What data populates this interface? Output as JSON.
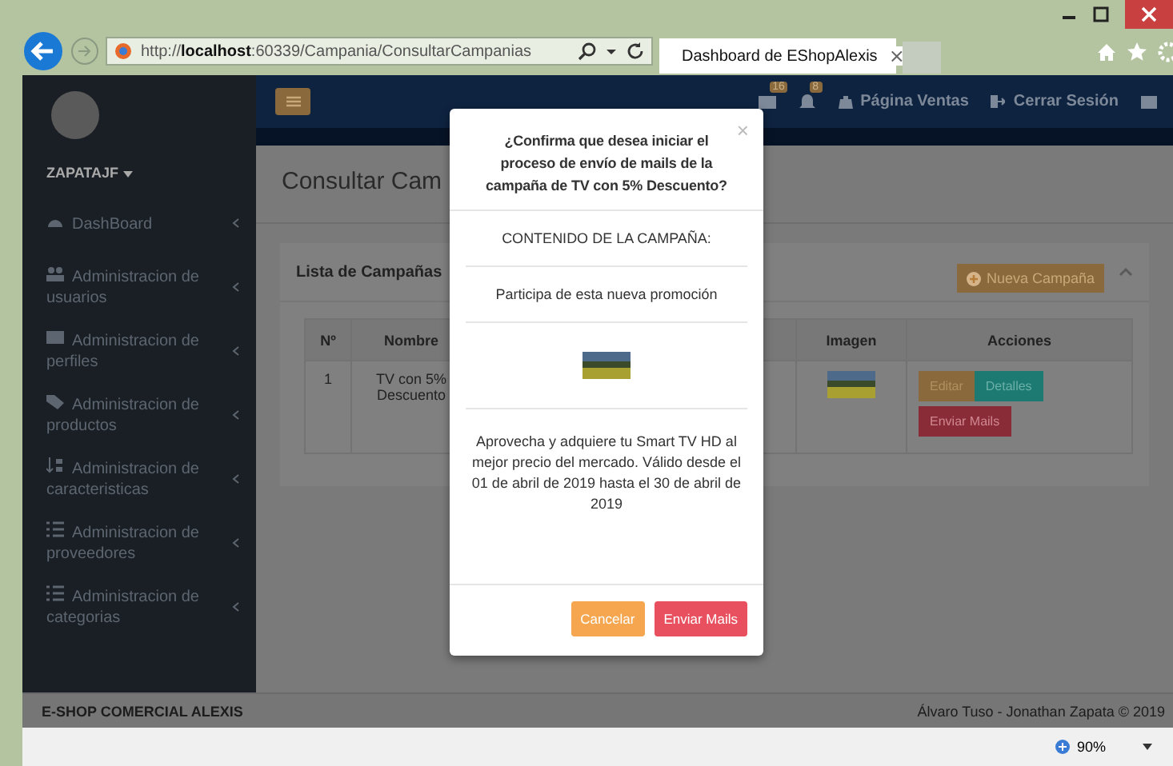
{
  "browser": {
    "url": "http://**localhost**:60339/Campania/ConsultarCampanias",
    "tab": {
      "title": "Dashboard de EShopAlexis",
      "close": "×"
    },
    "zoom": "90%"
  },
  "sidebar": {
    "user": "ZAPATAJF",
    "items": [
      {
        "label": "DashBoard"
      },
      {
        "label": "Administracion de usuarios"
      },
      {
        "label": "Administracion de perfiles"
      },
      {
        "label": "Administracion de productos"
      },
      {
        "label": "Administracion de caracteristicas"
      },
      {
        "label": "Administracion de proveedores"
      },
      {
        "label": "Administracion de categorias"
      }
    ]
  },
  "header": {
    "badges": [
      {
        "count": "16"
      },
      {
        "count": "8"
      }
    ],
    "links": [
      {
        "label": "Página Ventas"
      },
      {
        "label": "Cerrar Sesión"
      }
    ]
  },
  "page": {
    "title": "Consultar Cam",
    "panel": {
      "title": "Lista de Campañas",
      "new_button": "Nueva Campaña"
    },
    "table": {
      "columns": [
        "Nº",
        "Nombre",
        "Imagen",
        "Acciones"
      ],
      "rows": [
        {
          "number": "1",
          "name": "TV con 5% Descuento",
          "actions": [
            "Editar",
            "Detalles",
            "Enviar Mails"
          ]
        }
      ]
    }
  },
  "footer": {
    "left": "E-SHOP COMERCIAL ALEXIS",
    "right": "Álvaro Tuso - Jonathan Zapata © 2019"
  },
  "modal": {
    "title": "¿Confirma que desea iniciar el proceso de envío de mails de la campaña de TV con 5% Descuento?",
    "close": "×",
    "heading": "CONTENIDO DE LA CAMPAÑA:",
    "subtitle": "Participa de esta nueva promoción",
    "body": "Aprovecha y adquiere tu Smart TV HD al mejor precio del mercado. Válido desde el 01 de abril de 2019 hasta el 30 de abril de 2019",
    "buttons": [
      {
        "label": "Cancelar",
        "kind": "cancel"
      },
      {
        "label": "Enviar Mails",
        "kind": "confirm"
      }
    ]
  }
}
